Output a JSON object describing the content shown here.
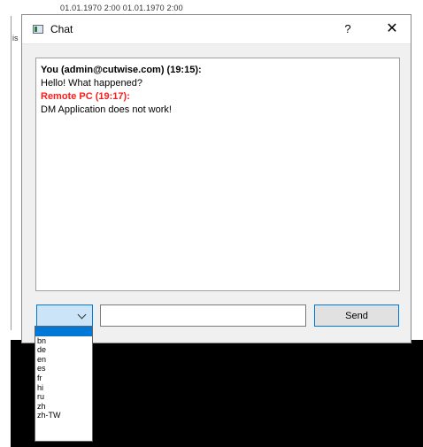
{
  "background": {
    "datetime_text": "01.01.1970 2:00  01.01.1970 2:00",
    "side_text": "is"
  },
  "window": {
    "title": "Chat",
    "help_label": "?",
    "close_label": "✕",
    "icon": "app-window-icon"
  },
  "messages": [
    {
      "sender": "You (admin@cutwise.com) (19:15):",
      "text": "Hello! What happened?",
      "sender_color": "#000000"
    },
    {
      "sender": "Remote PC (19:17):",
      "text": "DM Application does not work!",
      "sender_color": "#ff1a1a"
    }
  ],
  "composer": {
    "language_selected": "",
    "message_value": "",
    "send_label": "Send"
  },
  "language_options": [
    "",
    "bn",
    "de",
    "en",
    "es",
    "fr",
    "hi",
    "ru",
    "zh",
    "zh-TW"
  ],
  "colors": {
    "accent": "#0078d7",
    "remote_sender": "#ff1a1a",
    "combo_bg": "#cce4f7"
  }
}
